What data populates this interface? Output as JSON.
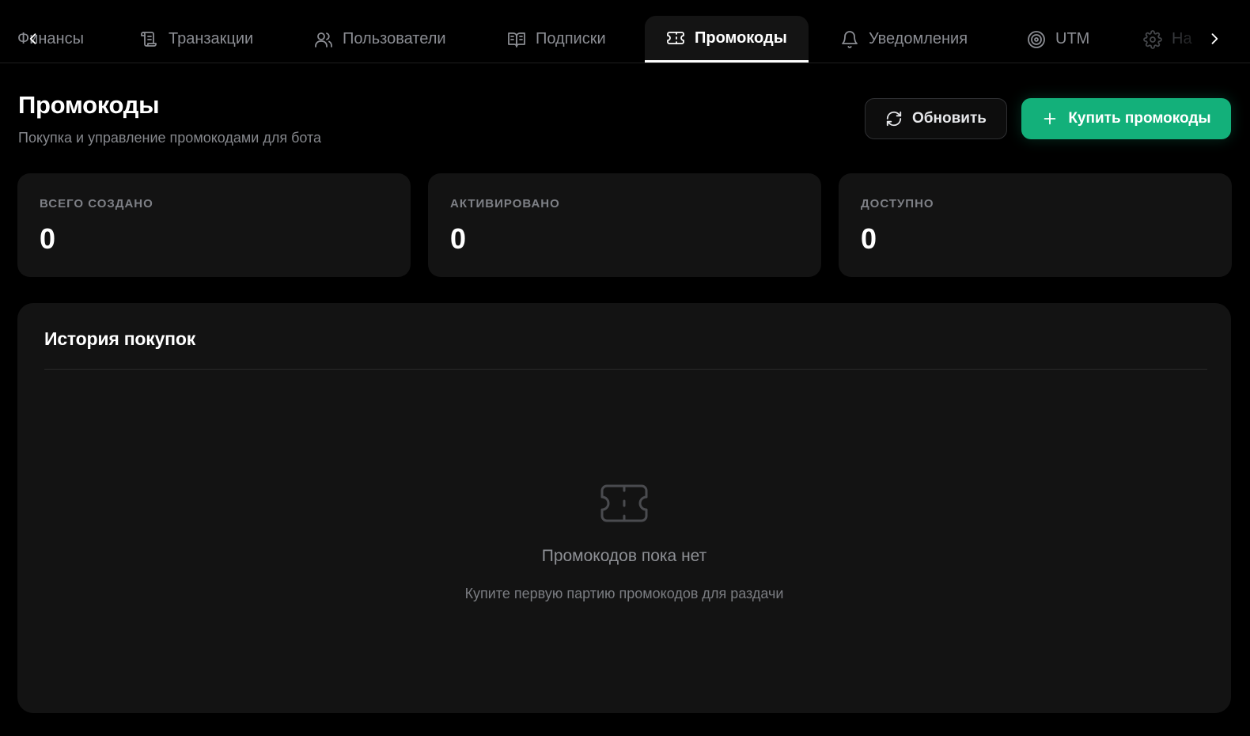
{
  "tabs": {
    "items": [
      {
        "label": "Финансы",
        "icon": "wallet-icon"
      },
      {
        "label": "Транзакции",
        "icon": "scroll-icon"
      },
      {
        "label": "Пользователи",
        "icon": "users-icon"
      },
      {
        "label": "Подписки",
        "icon": "book-icon"
      },
      {
        "label": "Промокоды",
        "icon": "ticket-icon",
        "active": true
      },
      {
        "label": "Уведомления",
        "icon": "bell-icon"
      },
      {
        "label": "UTM",
        "icon": "target-icon"
      },
      {
        "label": "На",
        "icon": "gear-icon"
      }
    ]
  },
  "header": {
    "title": "Промокоды",
    "subtitle": "Покупка и управление промокодами для бота",
    "refresh_label": "Обновить",
    "buy_label": "Купить промокоды"
  },
  "stats": [
    {
      "label": "ВСЕГО СОЗДАНО",
      "value": "0"
    },
    {
      "label": "АКТИВИРОВАНО",
      "value": "0"
    },
    {
      "label": "ДОСТУПНО",
      "value": "0"
    }
  ],
  "history": {
    "title": "История покупок",
    "empty_title": "Промокодов пока нет",
    "empty_text": "Купите первую партию промокодов для раздачи"
  },
  "colors": {
    "accent": "#13b07a",
    "background": "#000000",
    "card": "#131313"
  }
}
